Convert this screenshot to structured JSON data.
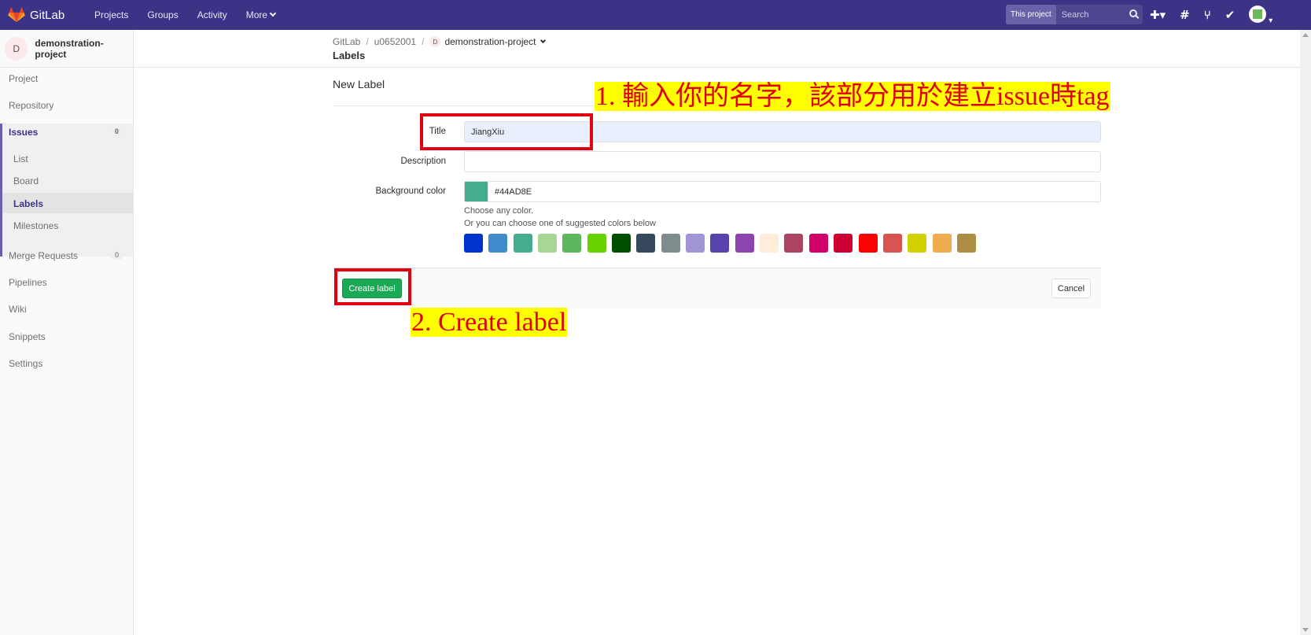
{
  "navbar": {
    "brand": "GitLab",
    "links": [
      "Projects",
      "Groups",
      "Activity",
      "More"
    ],
    "search_scope": "This project",
    "search_placeholder": "Search",
    "bg_color": "#3b3486"
  },
  "sidebar": {
    "project_initial": "D",
    "project_name": "demonstration-project",
    "items": {
      "project": "Project",
      "repository": "Repository",
      "issues": "Issues",
      "issues_count": "0",
      "list": "List",
      "board": "Board",
      "labels": "Labels",
      "milestones": "Milestones",
      "merge_requests": "Merge Requests",
      "merge_requests_count": "0",
      "pipelines": "Pipelines",
      "wiki": "Wiki",
      "snippets": "Snippets",
      "settings": "Settings"
    }
  },
  "breadcrumb": {
    "root": "GitLab",
    "user": "u0652001",
    "project_initial": "D",
    "project": "demonstration-project",
    "current": "Labels"
  },
  "form": {
    "heading": "New Label",
    "title_label": "Title",
    "title_value": "JiangXiu",
    "description_label": "Description",
    "description_value": "",
    "bg_label": "Background color",
    "bg_value": "#44AD8E",
    "help_1": "Choose any color.",
    "help_2": "Or you can choose one of suggested colors below",
    "suggested_colors": [
      "#0033CC",
      "#428BCA",
      "#44AD8E",
      "#A8D695",
      "#5CB85C",
      "#69D100",
      "#004E00",
      "#34495E",
      "#7F8C8D",
      "#A295D6",
      "#5843AD",
      "#8E44AD",
      "#FFECDB",
      "#AD4363",
      "#D10069",
      "#CC0033",
      "#FF0000",
      "#D9534F",
      "#D1D100",
      "#F0AD4E",
      "#AD8D43"
    ],
    "create_button": "Create label",
    "cancel_button": "Cancel"
  },
  "annotations": {
    "step1": "1. 輸入你的名字，該部分用於建立issue時tag",
    "step2": "2. Create label"
  }
}
